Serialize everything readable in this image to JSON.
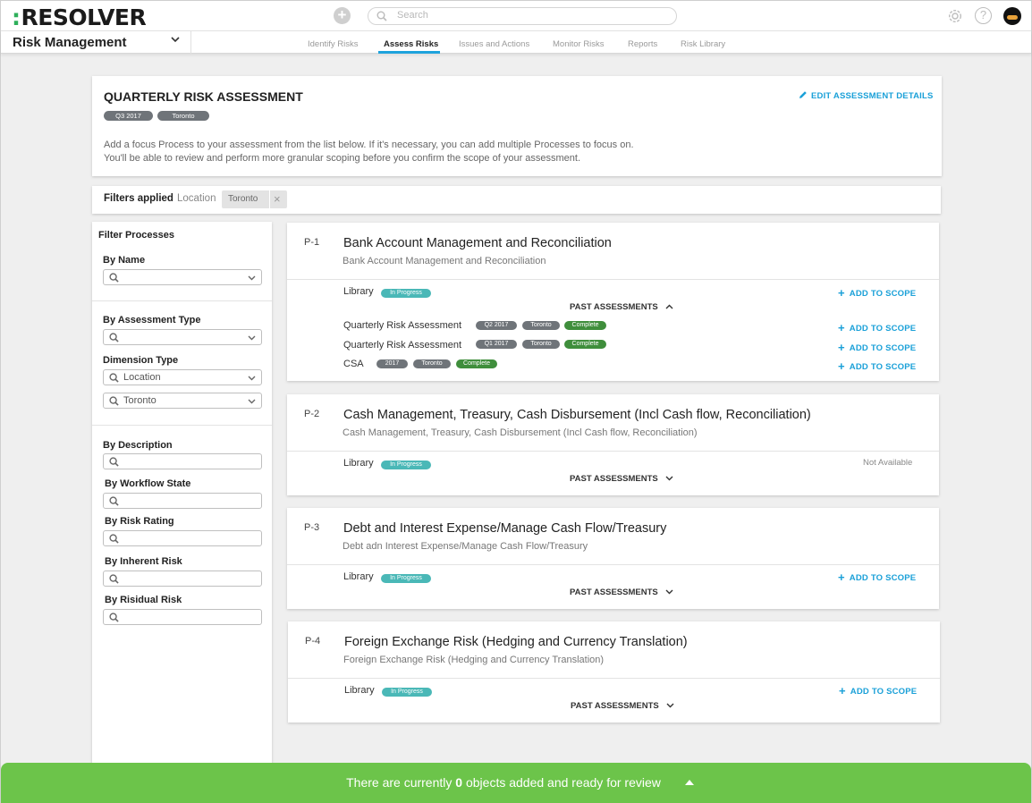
{
  "brand": {
    "logo_dots": ":",
    "logo_text": "RESOLVER"
  },
  "topbar": {
    "search_placeholder": "Search",
    "help_label": "?"
  },
  "app_selector": {
    "label": "Risk Management"
  },
  "nav_tabs": [
    "Identify Risks",
    "Assess Risks",
    "Issues and Actions",
    "Monitor Risks",
    "Reports",
    "Risk Library"
  ],
  "assessment": {
    "title": "QUARTERLY RISK ASSESSMENT",
    "tags": [
      "Q3 2017",
      "Toronto"
    ],
    "edit_label": "EDIT ASSESSMENT DETAILS",
    "description_line1": "Add a focus Process to your assessment from the list below. If it's necessary, you can add multiple Processes to focus on.",
    "description_line2": "You'll be able to review and perform more granular scoping before you confirm the scope of your assessment."
  },
  "filters_bar": {
    "label": "Filters applied",
    "field": "Location",
    "chip": "Toronto",
    "remove": "×"
  },
  "filter_panel": {
    "title": "Filter Processes",
    "by_name": "By Name",
    "by_assessment_type": "By Assessment Type",
    "dimension_type": "Dimension Type",
    "dimension_value": "Location",
    "dimension_sub_value": "Toronto",
    "by_description": "By Description",
    "by_workflow_state": "By Workflow State",
    "by_risk_rating": "By Risk Rating",
    "by_inherent_risk": "By Inherent Risk",
    "by_residual_risk": "By Risidual Risk"
  },
  "common": {
    "library": "Library",
    "in_progress": "In Progress",
    "past_assessments": "PAST ASSESSMENTS",
    "add_to_scope": "ADD TO SCOPE",
    "not_available": "Not Available",
    "complete": "Complete"
  },
  "processes": [
    {
      "id": "P-1",
      "name": "Bank Account Management and Reconciliation",
      "subtitle": "Bank Account Management and Reconciliation",
      "past": [
        {
          "name": "Quarterly Risk Assessment",
          "period": "Q2 2017",
          "location": "Toronto",
          "status": "Complete"
        },
        {
          "name": "Quarterly Risk Assessment",
          "period": "Q1 2017",
          "location": "Toronto",
          "status": "Complete"
        },
        {
          "name": "CSA",
          "period": "2017",
          "location": "Toronto",
          "status": "Complete"
        }
      ]
    },
    {
      "id": "P-2",
      "name": "Cash Management, Treasury, Cash Disbursement (Incl Cash flow, Reconciliation)",
      "subtitle": "Cash Management, Treasury, Cash Disbursement (Incl Cash flow, Reconciliation)"
    },
    {
      "id": "P-3",
      "name": "Debt and Interest Expense/Manage Cash Flow/Treasury",
      "subtitle": "Debt adn Interest Expense/Manage Cash Flow/Treasury"
    },
    {
      "id": "P-4",
      "name": "Foreign Exchange Risk (Hedging and Currency Translation)",
      "subtitle": "Foreign Exchange Risk (Hedging and Currency Translation)"
    }
  ],
  "bottom_bar": {
    "prefix": "There are currently",
    "count": "0",
    "suffix": "objects added and ready for review"
  },
  "colors": {
    "accent": "#1aa0d8",
    "success": "#6cc44a",
    "complete": "#3f8e3c",
    "in_progress": "#4ab8b7",
    "tag": "#6f7479"
  }
}
